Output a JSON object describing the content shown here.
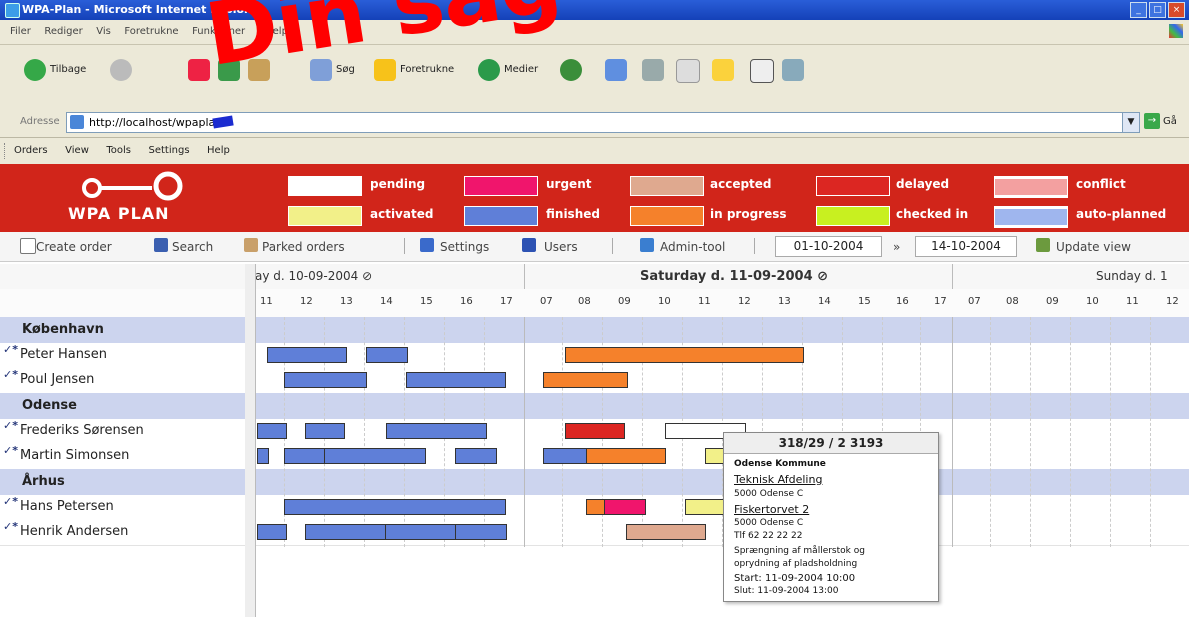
{
  "window": {
    "title": "WPA-Plan - Microsoft Internet Explorer",
    "controls": [
      "_",
      "□",
      "×"
    ]
  },
  "ie_menu": [
    "Filer",
    "Rediger",
    "Vis",
    "Foretrukne",
    "Funktioner",
    "Hjælp"
  ],
  "ie_toolbar": {
    "back_label": "Tilbage",
    "search_label": "Søg",
    "favorites_label": "Foretrukne",
    "media_label": "Medier"
  },
  "address": {
    "label": "Adresse",
    "url": "http://localhost/wpaplan",
    "go_label": "Gå"
  },
  "watermark": {
    "text": "Din sag",
    "color": "#ff0000"
  },
  "app_menu": [
    "Orders",
    "View",
    "Tools",
    "Settings",
    "Help"
  ],
  "logo": {
    "text": "WPA PLAN"
  },
  "legend": [
    {
      "label": "pending",
      "color": "#ffffff"
    },
    {
      "label": "urgent",
      "color": "#f0156c"
    },
    {
      "label": "accepted",
      "color": "#dfa98f"
    },
    {
      "label": "delayed",
      "color": "#dc2622"
    },
    {
      "label": "conflict",
      "color": "#f3a0a0"
    },
    {
      "label": "activated",
      "color": "#f2f089"
    },
    {
      "label": "finished",
      "color": "#5f7fd8"
    },
    {
      "label": "in progress",
      "color": "#f5812b"
    },
    {
      "label": "checked in",
      "color": "#c8f020"
    },
    {
      "label": "auto-planned",
      "color": "#9fb6ee"
    }
  ],
  "toolbar": {
    "create_order": "Create order",
    "search": "Search",
    "parked": "Parked orders",
    "settings": "Settings",
    "users": "Users",
    "admin": "Admin-tool",
    "date_from": "01-10-2004",
    "arrow": "»",
    "date_to": "14-10-2004",
    "update": "Update view"
  },
  "days": [
    {
      "label": "ay d. 10-09-2004 ⊘"
    },
    {
      "label": "Saturday d. 11-09-2004 ⊘"
    },
    {
      "label": "Sunday d. 1"
    }
  ],
  "hours_day1": [
    "11",
    "12",
    "13",
    "14",
    "15",
    "16",
    "17"
  ],
  "hours_day2": [
    "07",
    "08",
    "09",
    "10",
    "11",
    "12",
    "13",
    "14",
    "15",
    "16",
    "17"
  ],
  "hours_day3": [
    "07",
    "08",
    "09",
    "10",
    "11",
    "12"
  ],
  "groups": [
    {
      "name": "København",
      "people": [
        "Peter Hansen",
        "Poul Jensen"
      ]
    },
    {
      "name": "Odense",
      "people": [
        "Frederiks Sørensen",
        "Martin Simonsen"
      ]
    },
    {
      "name": "Århus",
      "people": [
        "Hans Petersen",
        "Henrik Andersen"
      ]
    }
  ],
  "tooltip": {
    "title": "318/29 / 2 3193",
    "lines": [
      "Odense Kommune",
      "Teknisk Afdeling",
      "5000  Odense C",
      "Fiskertorvet 2",
      "5000 Odense C",
      "Tlf 62 22 22 22",
      "Sprængning af mållerstok og",
      "oprydning af pladsholdning",
      "Start: 11-09-2004 10:00",
      "Slut: 11-09-2004 13:00"
    ]
  }
}
